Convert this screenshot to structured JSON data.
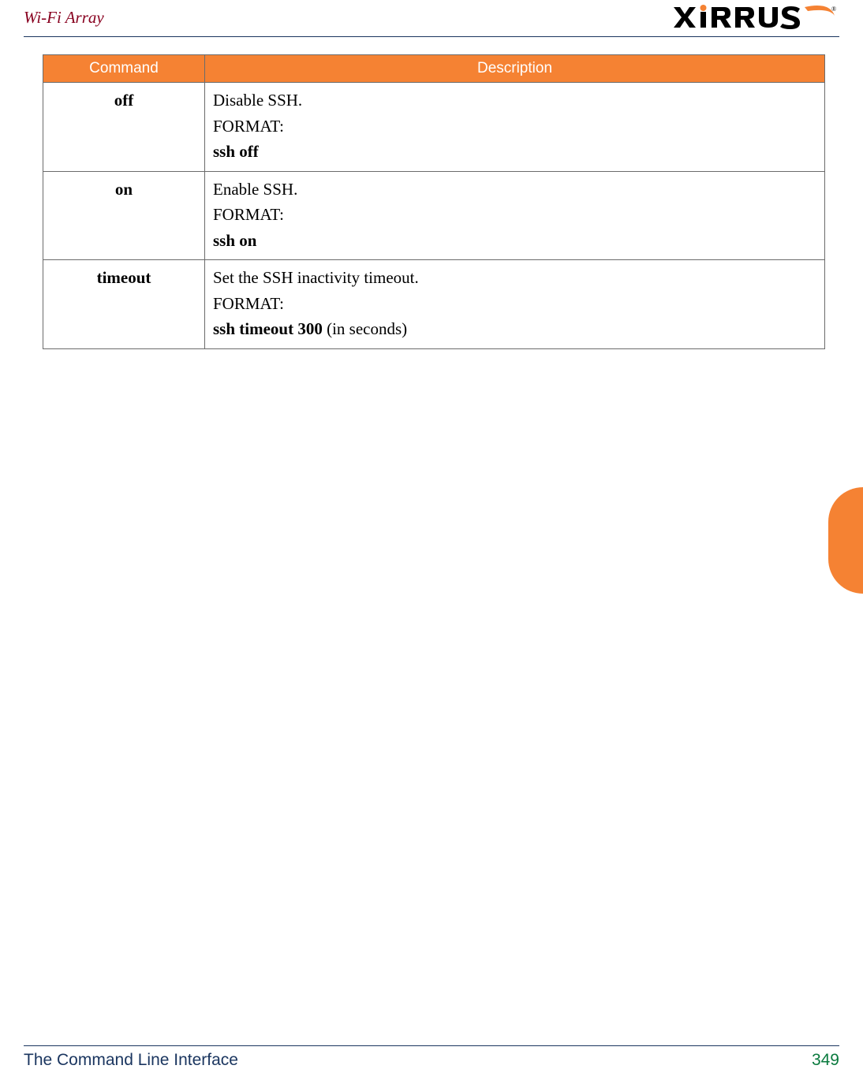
{
  "header": {
    "title": "Wi-Fi Array",
    "logo_text": "XIRRUS",
    "logo_tm": "®"
  },
  "chart_data": {
    "type": "table",
    "headers": {
      "command": "Command",
      "description": "Description"
    },
    "rows": [
      {
        "command": "off",
        "desc_main": "Disable SSH.",
        "format_label": "FORMAT:",
        "example_bold": "ssh off",
        "example_suffix": ""
      },
      {
        "command": "on",
        "desc_main": "Enable SSH.",
        "format_label": "FORMAT:",
        "example_bold": "ssh on",
        "example_suffix": ""
      },
      {
        "command": "timeout",
        "desc_main": "Set the SSH inactivity timeout.",
        "format_label": "FORMAT:",
        "example_bold": "ssh timeout 300",
        "example_suffix": " (in seconds)"
      }
    ]
  },
  "footer": {
    "title": "The Command Line Interface",
    "page": "349"
  },
  "colors": {
    "accent_orange": "#f58233",
    "header_line": "#1a355f",
    "title_maroon": "#88001f",
    "page_green": "#0a7a3e"
  }
}
